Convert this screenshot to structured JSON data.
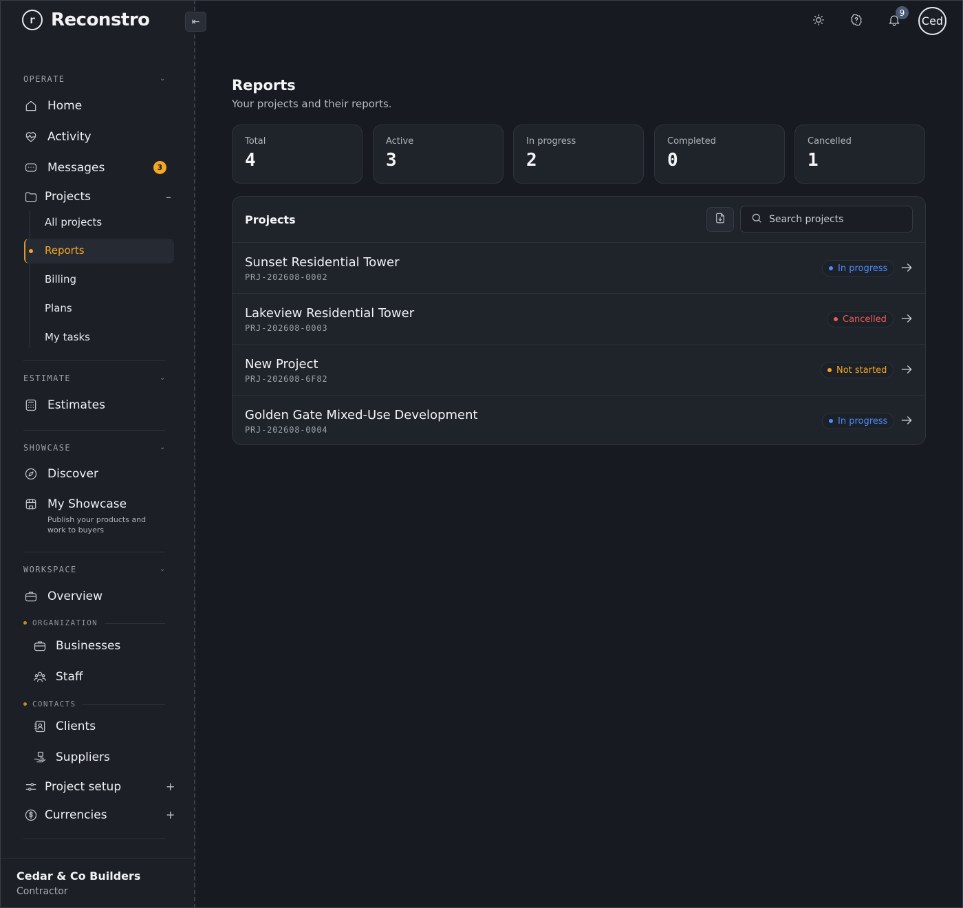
{
  "app": {
    "name": "Reconstro",
    "logo_letter": "r"
  },
  "sidebar": {
    "sections": {
      "operate": "OPERATE",
      "estimate": "ESTIMATE",
      "showcase": "SHOWCASE",
      "workspace": "WORKSPACE"
    },
    "items": {
      "home": "Home",
      "activity": "Activity",
      "messages": "Messages",
      "messages_badge": "3",
      "projects": "Projects",
      "estimates": "Estimates",
      "discover": "Discover",
      "my_showcase": "My Showcase",
      "my_showcase_desc": "Publish your products and work to buyers",
      "overview": "Overview",
      "businesses": "Businesses",
      "staff": "Staff",
      "clients": "Clients",
      "suppliers": "Suppliers",
      "project_setup": "Project setup",
      "currencies": "Currencies"
    },
    "projects_sub": {
      "all_projects": "All projects",
      "reports": "Reports",
      "billing": "Billing",
      "plans": "Plans",
      "my_tasks": "My tasks"
    },
    "groups": {
      "organization": "ORGANIZATION",
      "contacts": "CONTACTS"
    },
    "footer": {
      "company": "Cedar & Co Builders",
      "role": "Contractor"
    }
  },
  "topbar": {
    "notifications_count": "9",
    "avatar_text": "Ced"
  },
  "main": {
    "title": "Reports",
    "subtitle": "Your projects and their reports.",
    "stats": [
      {
        "label": "Total",
        "value": "4"
      },
      {
        "label": "Active",
        "value": "3"
      },
      {
        "label": "In progress",
        "value": "2"
      },
      {
        "label": "Completed",
        "value": "0"
      },
      {
        "label": "Cancelled",
        "value": "1"
      }
    ],
    "panel": {
      "title": "Projects",
      "search_placeholder": "Search projects",
      "rows": [
        {
          "name": "Sunset Residential Tower",
          "code": "PRJ-202608-0002",
          "status": "In progress",
          "status_color": "#4c8dff"
        },
        {
          "name": "Lakeview Residential Tower",
          "code": "PRJ-202608-0003",
          "status": "Cancelled",
          "status_color": "#ef5a5a"
        },
        {
          "name": "New Project",
          "code": "PRJ-202608-6F82",
          "status": "Not started",
          "status_color": "#f5a623"
        },
        {
          "name": "Golden Gate Mixed-Use Development",
          "code": "PRJ-202608-0004",
          "status": "In progress",
          "status_color": "#4c8dff"
        }
      ]
    }
  },
  "colors": {
    "accent": "#f5a623",
    "background": "#171a21",
    "sidebar": "#1c1f26"
  }
}
